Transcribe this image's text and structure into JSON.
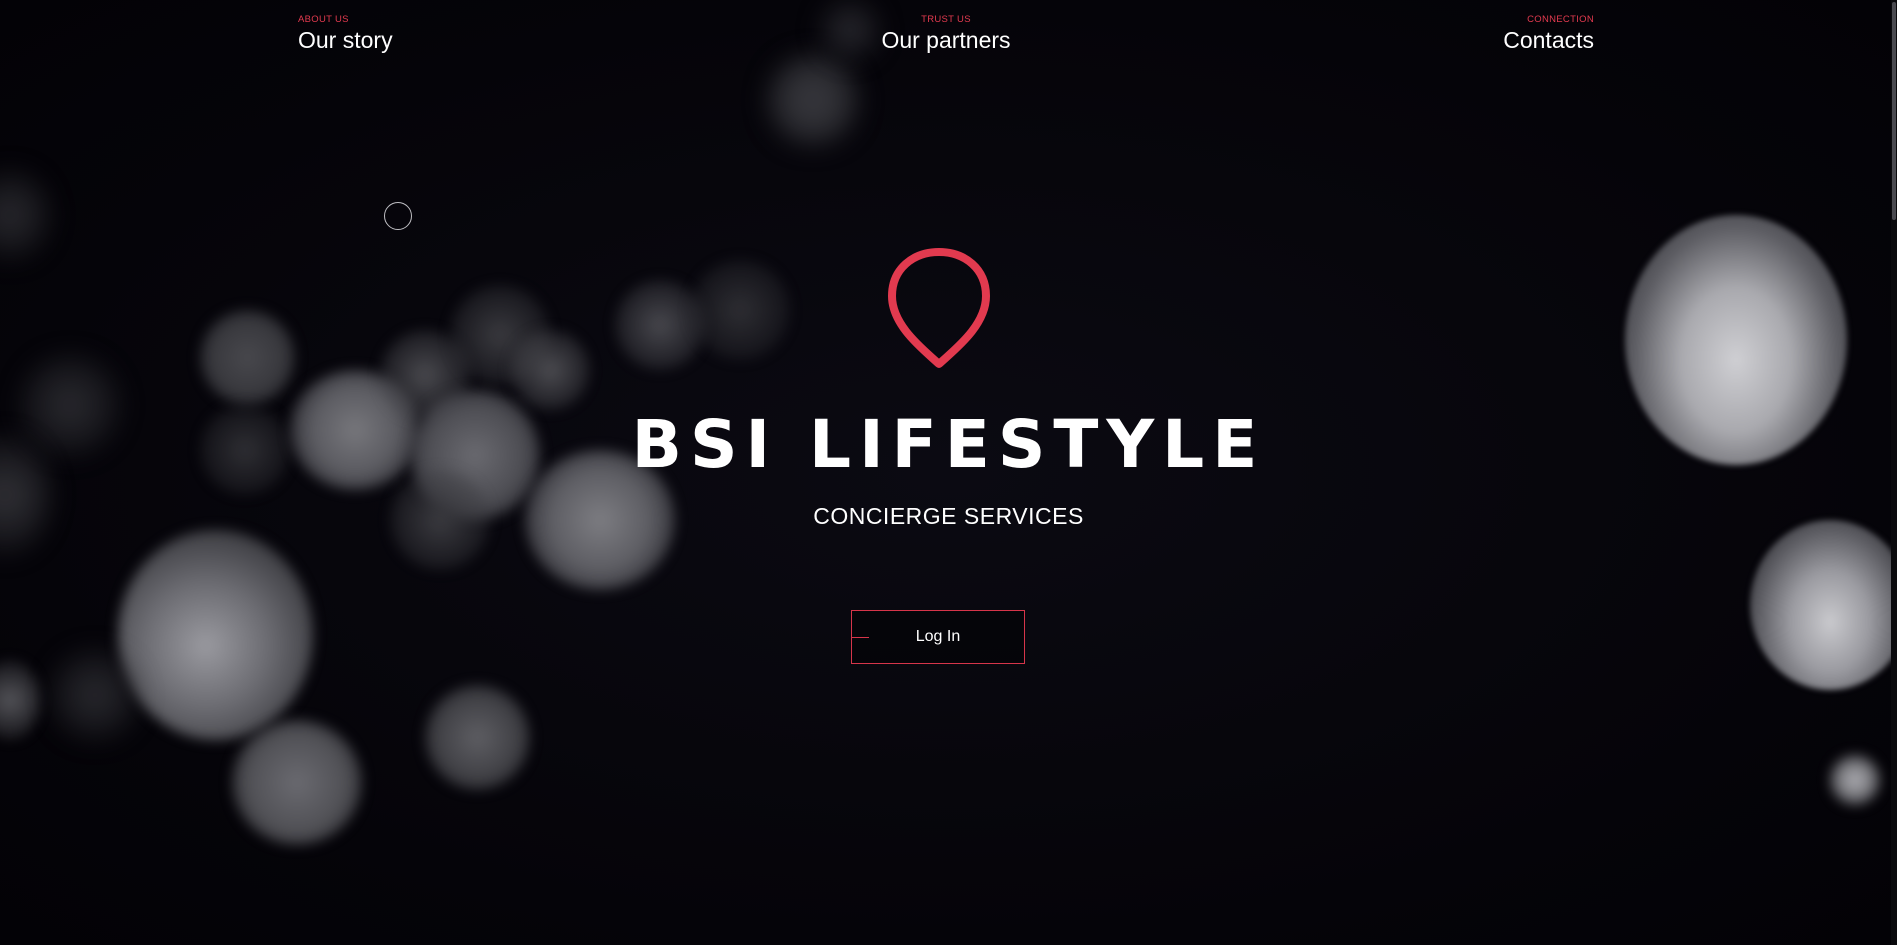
{
  "nav": {
    "items": [
      {
        "kicker": "ABOUT US",
        "title": "Our story"
      },
      {
        "kicker": "TRUST US",
        "title": "Our partners"
      },
      {
        "kicker": "CONNECTION",
        "title": "Contacts"
      }
    ]
  },
  "hero": {
    "logo_icon": "location-pin-icon",
    "title": "BSI LIFESTYLE",
    "subtitle": "CONCIERGE SERVICES",
    "login_label": "Log In"
  },
  "colors": {
    "accent": "#e23a4f",
    "background": "#06050a",
    "text": "#ffffff"
  }
}
